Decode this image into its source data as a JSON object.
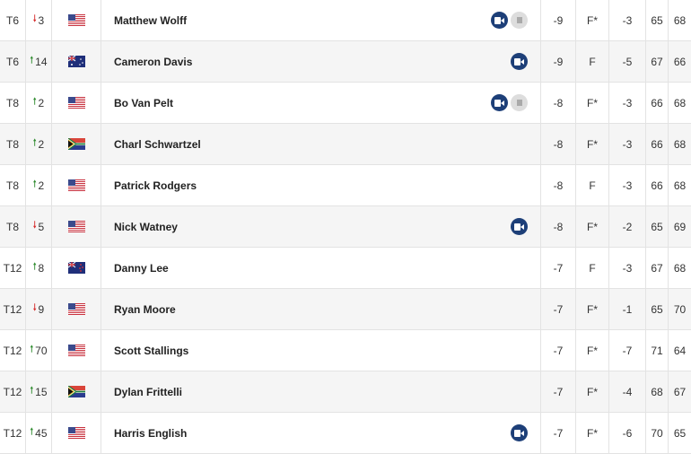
{
  "colors": {
    "video": "#1d3f78",
    "up": "#2e8b2e",
    "down": "#d62b2b",
    "alt_row": "#f5f5f5"
  },
  "rows": [
    {
      "pos": "T6",
      "dir": "down",
      "move": "3",
      "flag": "us",
      "name": "Matthew Wolff",
      "video": true,
      "card": true,
      "total": "-9",
      "thru": "F*",
      "today": "-3",
      "r1": "65",
      "r2": "68"
    },
    {
      "pos": "T6",
      "dir": "up",
      "move": "14",
      "flag": "au",
      "name": "Cameron Davis",
      "video": true,
      "card": false,
      "total": "-9",
      "thru": "F",
      "today": "-5",
      "r1": "67",
      "r2": "66"
    },
    {
      "pos": "T8",
      "dir": "up",
      "move": "2",
      "flag": "us",
      "name": "Bo Van Pelt",
      "video": true,
      "card": true,
      "total": "-8",
      "thru": "F*",
      "today": "-3",
      "r1": "66",
      "r2": "68"
    },
    {
      "pos": "T8",
      "dir": "up",
      "move": "2",
      "flag": "za",
      "name": "Charl Schwartzel",
      "video": false,
      "card": false,
      "total": "-8",
      "thru": "F*",
      "today": "-3",
      "r1": "66",
      "r2": "68"
    },
    {
      "pos": "T8",
      "dir": "up",
      "move": "2",
      "flag": "us",
      "name": "Patrick Rodgers",
      "video": false,
      "card": false,
      "total": "-8",
      "thru": "F",
      "today": "-3",
      "r1": "66",
      "r2": "68"
    },
    {
      "pos": "T8",
      "dir": "down",
      "move": "5",
      "flag": "us",
      "name": "Nick Watney",
      "video": true,
      "card": false,
      "total": "-8",
      "thru": "F*",
      "today": "-2",
      "r1": "65",
      "r2": "69"
    },
    {
      "pos": "T12",
      "dir": "up",
      "move": "8",
      "flag": "nz",
      "name": "Danny Lee",
      "video": false,
      "card": false,
      "total": "-7",
      "thru": "F",
      "today": "-3",
      "r1": "67",
      "r2": "68"
    },
    {
      "pos": "T12",
      "dir": "down",
      "move": "9",
      "flag": "us",
      "name": "Ryan Moore",
      "video": false,
      "card": false,
      "total": "-7",
      "thru": "F*",
      "today": "-1",
      "r1": "65",
      "r2": "70"
    },
    {
      "pos": "T12",
      "dir": "up",
      "move": "70",
      "flag": "us",
      "name": "Scott Stallings",
      "video": false,
      "card": false,
      "total": "-7",
      "thru": "F*",
      "today": "-7",
      "r1": "71",
      "r2": "64"
    },
    {
      "pos": "T12",
      "dir": "up",
      "move": "15",
      "flag": "za",
      "name": "Dylan Frittelli",
      "video": false,
      "card": false,
      "total": "-7",
      "thru": "F*",
      "today": "-4",
      "r1": "68",
      "r2": "67"
    },
    {
      "pos": "T12",
      "dir": "up",
      "move": "45",
      "flag": "us",
      "name": "Harris English",
      "video": true,
      "card": false,
      "total": "-7",
      "thru": "F*",
      "today": "-6",
      "r1": "70",
      "r2": "65"
    }
  ]
}
